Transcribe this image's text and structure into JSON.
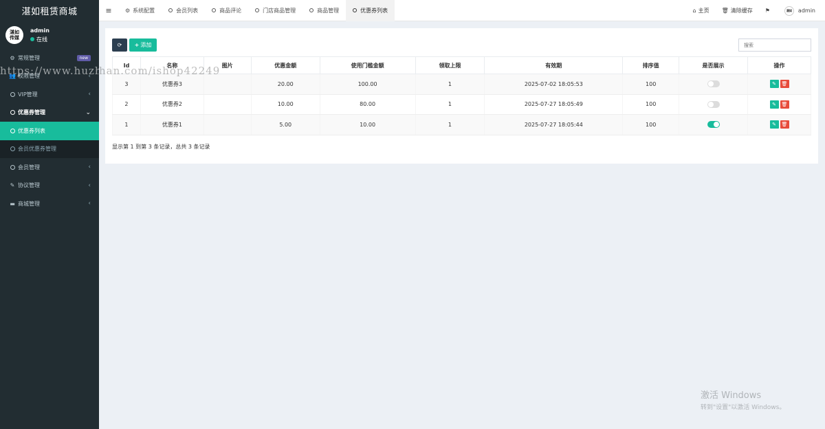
{
  "app": {
    "title": "湛如租赁商城"
  },
  "user": {
    "avatar_text": "湛如传媒",
    "name": "admin",
    "status": "在线"
  },
  "sidebar": {
    "items": [
      {
        "label": "常规管理",
        "badge": "new"
      },
      {
        "label": "权限管理"
      },
      {
        "label": "VIP管理"
      },
      {
        "label": "优惠券管理"
      },
      {
        "label": "优惠券列表"
      },
      {
        "label": "会员优惠券管理"
      },
      {
        "label": "会员管理"
      },
      {
        "label": "协议管理"
      },
      {
        "label": "商城管理"
      }
    ]
  },
  "tabs": [
    {
      "label": "系统配置",
      "icon": "gear-icon"
    },
    {
      "label": "会员列表",
      "icon": "circle-icon"
    },
    {
      "label": "商品评论",
      "icon": "circle-icon"
    },
    {
      "label": "门店商品管理",
      "icon": "circle-icon"
    },
    {
      "label": "商品管理",
      "icon": "circle-icon"
    },
    {
      "label": "优惠券列表",
      "icon": "circle-icon"
    }
  ],
  "topbar": {
    "home": "主页",
    "clear_cache": "清除缓存",
    "user": "admin"
  },
  "toolbar": {
    "add_label": "添加",
    "search_placeholder": "搜索"
  },
  "table": {
    "headers": [
      "Id",
      "名称",
      "图片",
      "优惠金额",
      "使用门槛金额",
      "领取上限",
      "有效期",
      "排序值",
      "是否展示",
      "操作"
    ],
    "rows": [
      {
        "id": "3",
        "name": "优惠券3",
        "image": "",
        "amount": "20.00",
        "threshold": "100.00",
        "limit": "1",
        "expire": "2025-07-02 18:05:53",
        "sort": "100",
        "show": false
      },
      {
        "id": "2",
        "name": "优惠券2",
        "image": "",
        "amount": "10.00",
        "threshold": "80.00",
        "limit": "1",
        "expire": "2025-07-27 18:05:49",
        "sort": "100",
        "show": false
      },
      {
        "id": "1",
        "name": "优惠券1",
        "image": "",
        "amount": "5.00",
        "threshold": "10.00",
        "limit": "1",
        "expire": "2025-07-27 18:05:44",
        "sort": "100",
        "show": true
      }
    ],
    "summary": "显示第 1 到第 3 条记录，总共 3 条记录"
  },
  "watermark": "https://www.huzhan.com/ishop42249",
  "windows": {
    "line1": "激活 Windows",
    "line2": "转到\"设置\"以激活 Windows。"
  },
  "colors": {
    "sidebar_bg": "#222d32",
    "accent": "#18bc9c",
    "danger": "#e74c3c",
    "dark_btn": "#2c3e50"
  }
}
